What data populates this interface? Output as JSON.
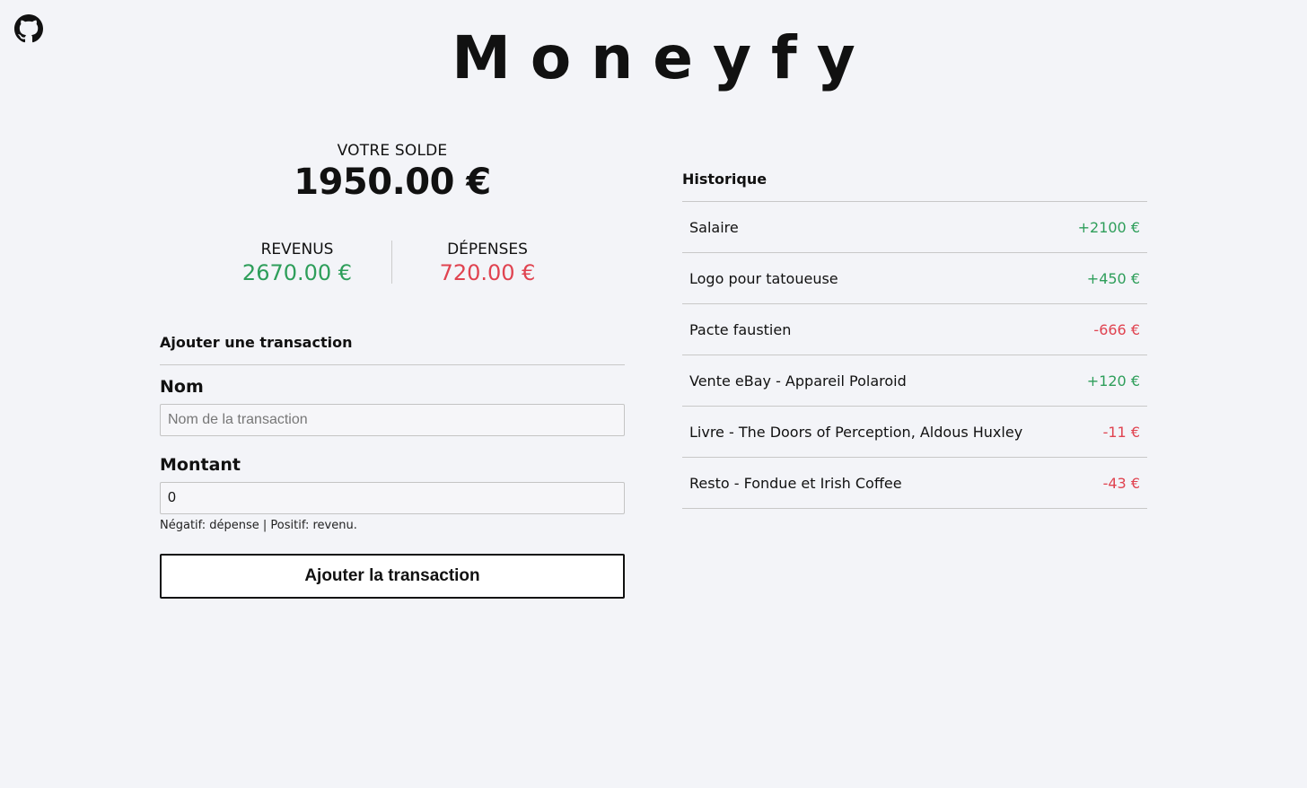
{
  "app": {
    "title": "Moneyfy"
  },
  "icons": {
    "github": "github-icon"
  },
  "balance": {
    "label": "VOTRE SOLDE",
    "value": "1950.00 €"
  },
  "summary": {
    "income_label": "REVENUS",
    "income_value": "2670.00 €",
    "expense_label": "DÉPENSES",
    "expense_value": "720.00 €"
  },
  "form": {
    "title": "Ajouter une transaction",
    "name_label": "Nom",
    "name_placeholder": "Nom de la transaction",
    "name_value": "",
    "amount_label": "Montant",
    "amount_value": "0",
    "hint": "Négatif: dépense | Positif: revenu.",
    "submit_label": "Ajouter la transaction"
  },
  "history": {
    "title": "Historique",
    "items": [
      {
        "name": "Salaire",
        "amount": "+2100 €",
        "type": "income"
      },
      {
        "name": "Logo pour tatoueuse",
        "amount": "+450 €",
        "type": "income"
      },
      {
        "name": "Pacte faustien",
        "amount": "-666 €",
        "type": "expense"
      },
      {
        "name": "Vente eBay - Appareil Polaroid",
        "amount": "+120 €",
        "type": "income"
      },
      {
        "name": "Livre - The Doors of Perception, Aldous Huxley",
        "amount": "-11 €",
        "type": "expense"
      },
      {
        "name": "Resto - Fondue et Irish Coffee",
        "amount": "-43 €",
        "type": "expense"
      }
    ]
  },
  "colors": {
    "income": "#2e9e5a",
    "expense": "#e04350",
    "background": "#f3f4f8"
  }
}
